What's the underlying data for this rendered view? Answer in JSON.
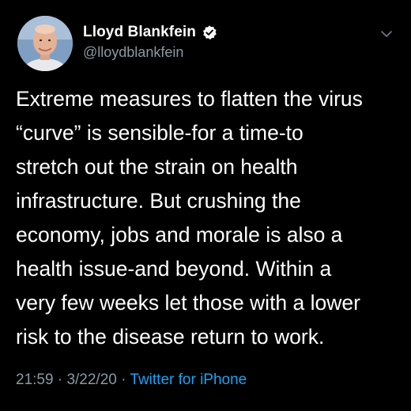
{
  "user": {
    "display_name": "Lloyd Blankfein",
    "handle": "@lloydblankfein",
    "verified": true
  },
  "tweet": {
    "lines": [
      "Extreme measures to flatten the virus",
      "“curve” is sensible-for a time-to",
      "stretch out the strain on health",
      "infrastructure. But crushing the",
      "economy, jobs and morale is also a",
      "health issue-and beyond. Within a",
      "very few weeks let those with a lower",
      "risk to the disease return to work."
    ],
    "time": "21:59",
    "separator1": " · ",
    "date": "3/22/20",
    "separator2": " · ",
    "source": "Twitter for iPhone"
  },
  "icons": {
    "verified": "verified-badge-icon",
    "menu": "chevron-down-icon"
  },
  "colors": {
    "background": "#000000",
    "text": "#ffffff",
    "muted": "#8899a6",
    "link": "#1da1f2"
  }
}
